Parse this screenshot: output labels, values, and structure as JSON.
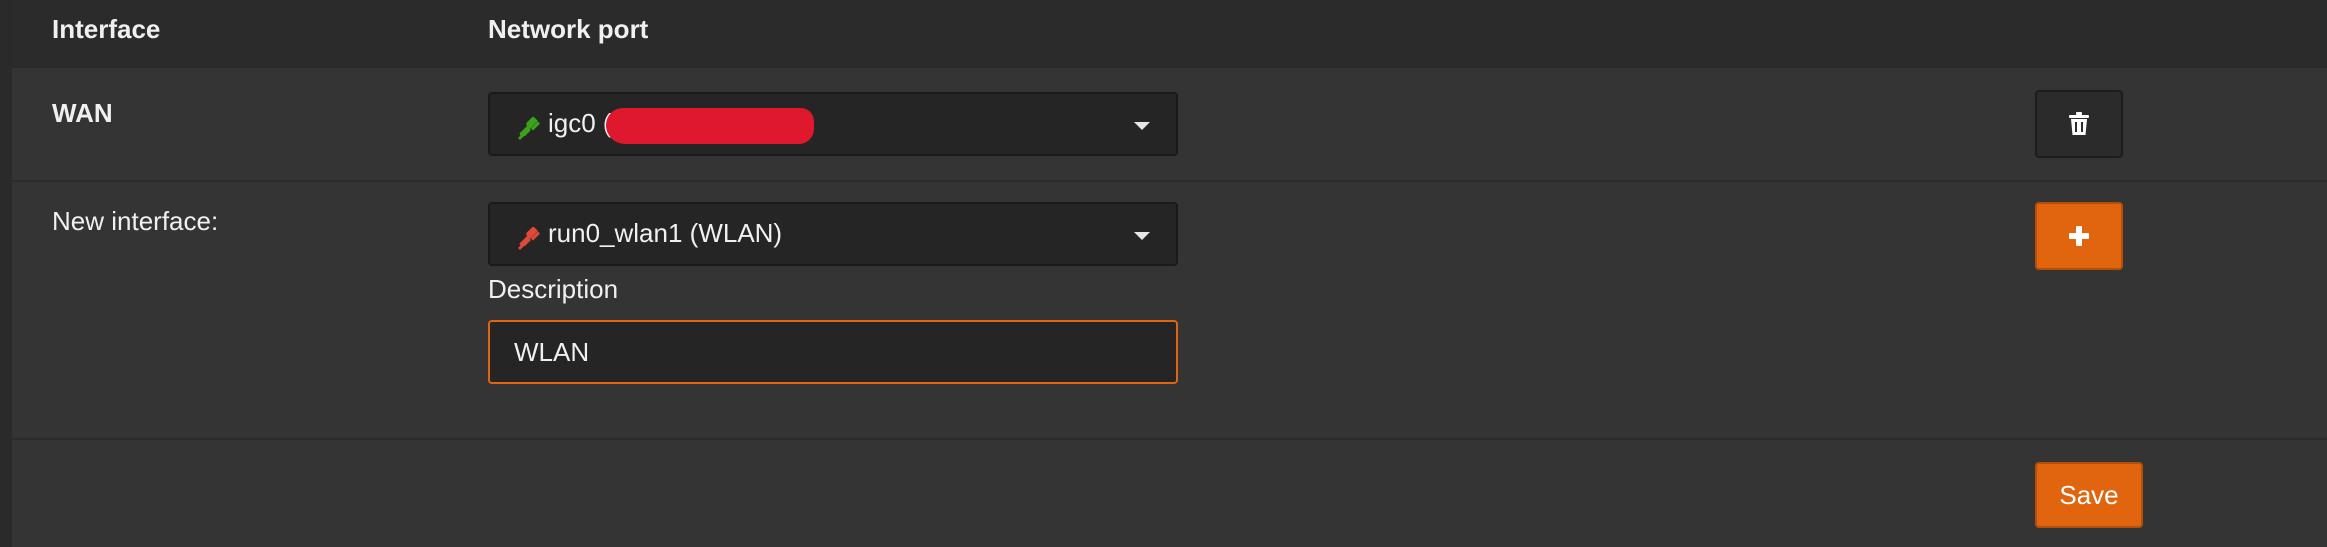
{
  "table": {
    "headers": {
      "interface": "Interface",
      "network_port": "Network port"
    }
  },
  "rows": {
    "wan": {
      "interface_label": "WAN",
      "port_value": "igc0 (",
      "port_status_color": "#3aa21d",
      "delete_icon": "trash-icon"
    },
    "new_interface": {
      "interface_label": "New interface:",
      "port_value": "run0_wlan1 (WLAN)",
      "port_status_color": "#e0483a",
      "description_label": "Description",
      "description_value": "WLAN",
      "add_icon": "plus-icon"
    }
  },
  "footer": {
    "save_label": "Save"
  },
  "colors": {
    "accent": "#e0650e",
    "redaction": "#e0182d",
    "background": "#343434"
  }
}
